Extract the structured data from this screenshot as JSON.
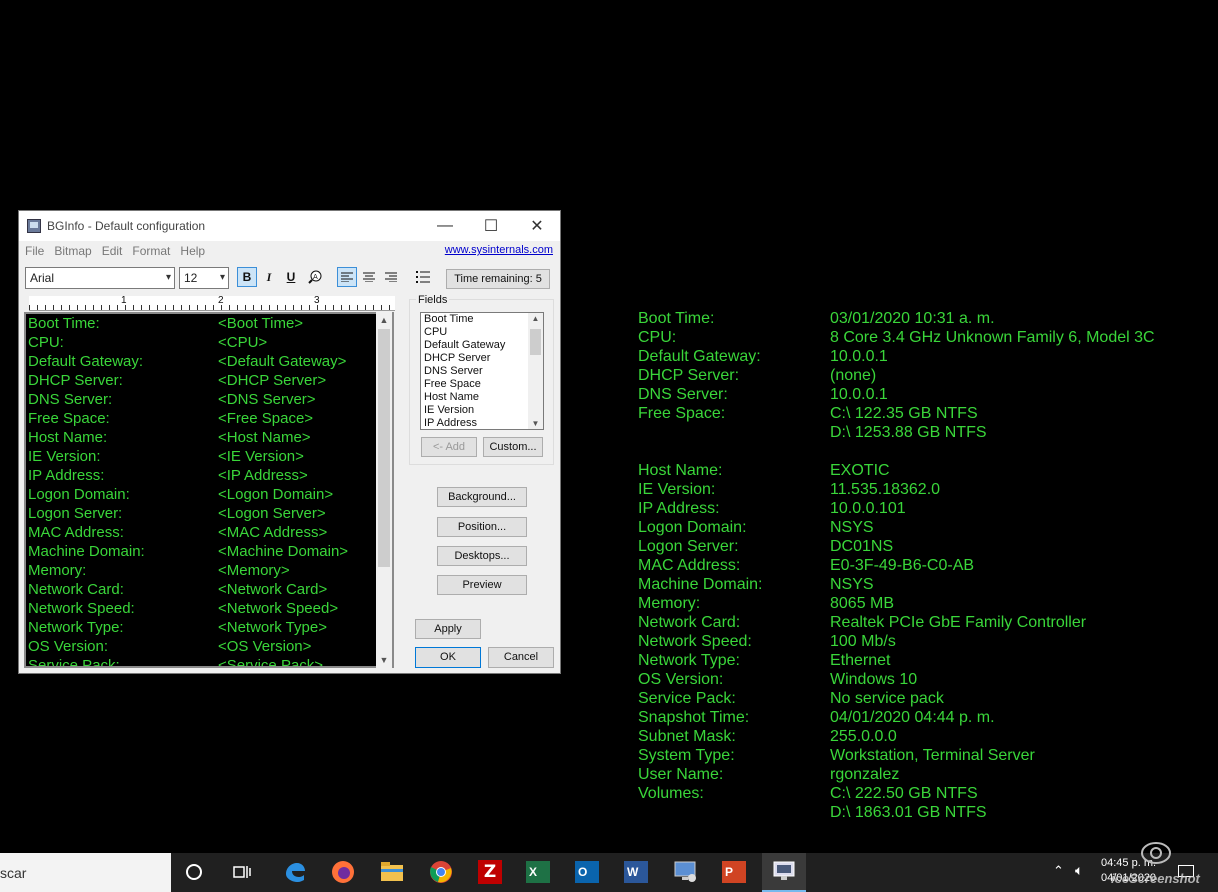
{
  "window": {
    "title": "BGInfo - Default configuration",
    "controls": {
      "minimize": "—",
      "maximize": "☐",
      "close": "✕"
    }
  },
  "menu": {
    "items": [
      "File",
      "Bitmap",
      "Edit",
      "Format",
      "Help"
    ],
    "link": "www.sysinternals.com"
  },
  "toolbar": {
    "font": "Arial",
    "size": "12",
    "bold": "B",
    "italic": "I",
    "underline": "U",
    "time_remaining": "Time remaining: 5"
  },
  "ruler": {
    "marks": [
      "1",
      "2",
      "3"
    ]
  },
  "editor": {
    "rows": [
      {
        "label": "Boot Time:",
        "tag": "<Boot Time>"
      },
      {
        "label": "CPU:",
        "tag": "<CPU>"
      },
      {
        "label": "Default Gateway:",
        "tag": "<Default Gateway>"
      },
      {
        "label": "DHCP Server:",
        "tag": "<DHCP Server>"
      },
      {
        "label": "DNS Server:",
        "tag": "<DNS Server>"
      },
      {
        "label": "Free Space:",
        "tag": "<Free Space>"
      },
      {
        "label": "Host Name:",
        "tag": "<Host Name>"
      },
      {
        "label": "IE Version:",
        "tag": "<IE Version>"
      },
      {
        "label": "IP Address:",
        "tag": "<IP Address>"
      },
      {
        "label": "Logon Domain:",
        "tag": "<Logon Domain>"
      },
      {
        "label": "Logon Server:",
        "tag": "<Logon Server>"
      },
      {
        "label": "MAC Address:",
        "tag": "<MAC Address>"
      },
      {
        "label": "Machine Domain:",
        "tag": "<Machine Domain>"
      },
      {
        "label": "Memory:",
        "tag": "<Memory>"
      },
      {
        "label": "Network Card:",
        "tag": "<Network Card>"
      },
      {
        "label": "Network Speed:",
        "tag": "<Network Speed>"
      },
      {
        "label": "Network Type:",
        "tag": "<Network Type>"
      },
      {
        "label": "OS Version:",
        "tag": "<OS Version>"
      },
      {
        "label": "Service Pack:",
        "tag": "<Service Pack>"
      }
    ]
  },
  "fields": {
    "title": "Fields",
    "items": [
      "Boot Time",
      "CPU",
      "Default Gateway",
      "DHCP Server",
      "DNS Server",
      "Free Space",
      "Host Name",
      "IE Version",
      "IP Address"
    ],
    "add_label": "<- Add",
    "custom_label": "Custom..."
  },
  "buttons": {
    "background": "Background...",
    "position": "Position...",
    "desktops": "Desktops...",
    "preview": "Preview",
    "apply": "Apply",
    "ok": "OK",
    "cancel": "Cancel"
  },
  "desktop_info": [
    {
      "label": "Boot Time:",
      "value": "03/01/2020 10:31 a. m."
    },
    {
      "label": "CPU:",
      "value": "8 Core 3.4 GHz Unknown Family 6, Model 3C"
    },
    {
      "label": "Default Gateway:",
      "value": "10.0.0.1"
    },
    {
      "label": "DHCP Server:",
      "value": "(none)"
    },
    {
      "label": "DNS Server:",
      "value": "10.0.0.1"
    },
    {
      "label": "Free Space:",
      "value": "C:\\ 122.35 GB NTFS"
    },
    {
      "label": "",
      "value": "D:\\ 1253.88 GB NTFS"
    },
    {
      "label": "",
      "value": ""
    },
    {
      "label": "Host Name:",
      "value": "EXOTIC"
    },
    {
      "label": "IE Version:",
      "value": "11.535.18362.0"
    },
    {
      "label": "IP Address:",
      "value": "10.0.0.101"
    },
    {
      "label": "Logon Domain:",
      "value": "NSYS"
    },
    {
      "label": "Logon Server:",
      "value": "DC01NS"
    },
    {
      "label": "MAC Address:",
      "value": "E0-3F-49-B6-C0-AB"
    },
    {
      "label": "Machine Domain:",
      "value": "NSYS"
    },
    {
      "label": "Memory:",
      "value": "8065 MB"
    },
    {
      "label": "Network Card:",
      "value": "Realtek PCIe GbE Family Controller"
    },
    {
      "label": "Network Speed:",
      "value": "100 Mb/s"
    },
    {
      "label": "Network Type:",
      "value": "Ethernet"
    },
    {
      "label": "OS Version:",
      "value": "Windows 10"
    },
    {
      "label": "Service Pack:",
      "value": "No service pack"
    },
    {
      "label": "Snapshot Time:",
      "value": "04/01/2020 04:44 p. m."
    },
    {
      "label": "Subnet Mask:",
      "value": "255.0.0.0"
    },
    {
      "label": "System Type:",
      "value": "Workstation, Terminal Server"
    },
    {
      "label": "User Name:",
      "value": "rgonzalez"
    },
    {
      "label": "Volumes:",
      "value": "C:\\ 222.50 GB NTFS"
    },
    {
      "label": "",
      "value": "D:\\ 1863.01 GB NTFS"
    }
  ],
  "taskbar": {
    "search_text": "scar",
    "time": "04:45 p. m.",
    "date": "04/01/2020",
    "watermark": "iceScreenshot",
    "apps": [
      "cortana-icon",
      "task-view-icon",
      "edge-icon",
      "firefox-icon",
      "file-explorer-icon",
      "chrome-icon",
      "filezilla-icon",
      "excel-icon",
      "outlook-icon",
      "word-icon",
      "remote-desktop-icon",
      "powerpoint-icon",
      "bginfo-icon"
    ]
  }
}
